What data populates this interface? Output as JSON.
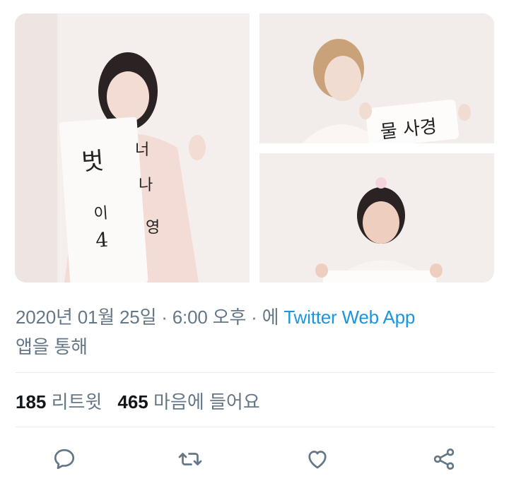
{
  "tweet": {
    "media": [
      {
        "name": "photo-1",
        "alt_icon": "image"
      },
      {
        "name": "photo-2",
        "alt_icon": "image"
      },
      {
        "name": "photo-3",
        "alt_icon": "image"
      }
    ],
    "meta": {
      "timestamp": "2020년 01월 25일 · 6:00 오후 · 에 ",
      "source": "Twitter Web App",
      "suffix": "앱을 통해"
    },
    "stats": {
      "retweets_count": "185",
      "retweets_label": " 리트윗",
      "likes_count": "465",
      "likes_label": " 마음에 들어요"
    },
    "actions": {
      "reply_icon": "reply-icon",
      "retweet_icon": "retweet-icon",
      "like_icon": "heart-icon",
      "share_icon": "share-icon"
    }
  },
  "colors": {
    "meta_gray": "#657786",
    "link_blue": "#1b95e0",
    "divider": "#e6ecf0",
    "text_dark": "#14171a"
  }
}
